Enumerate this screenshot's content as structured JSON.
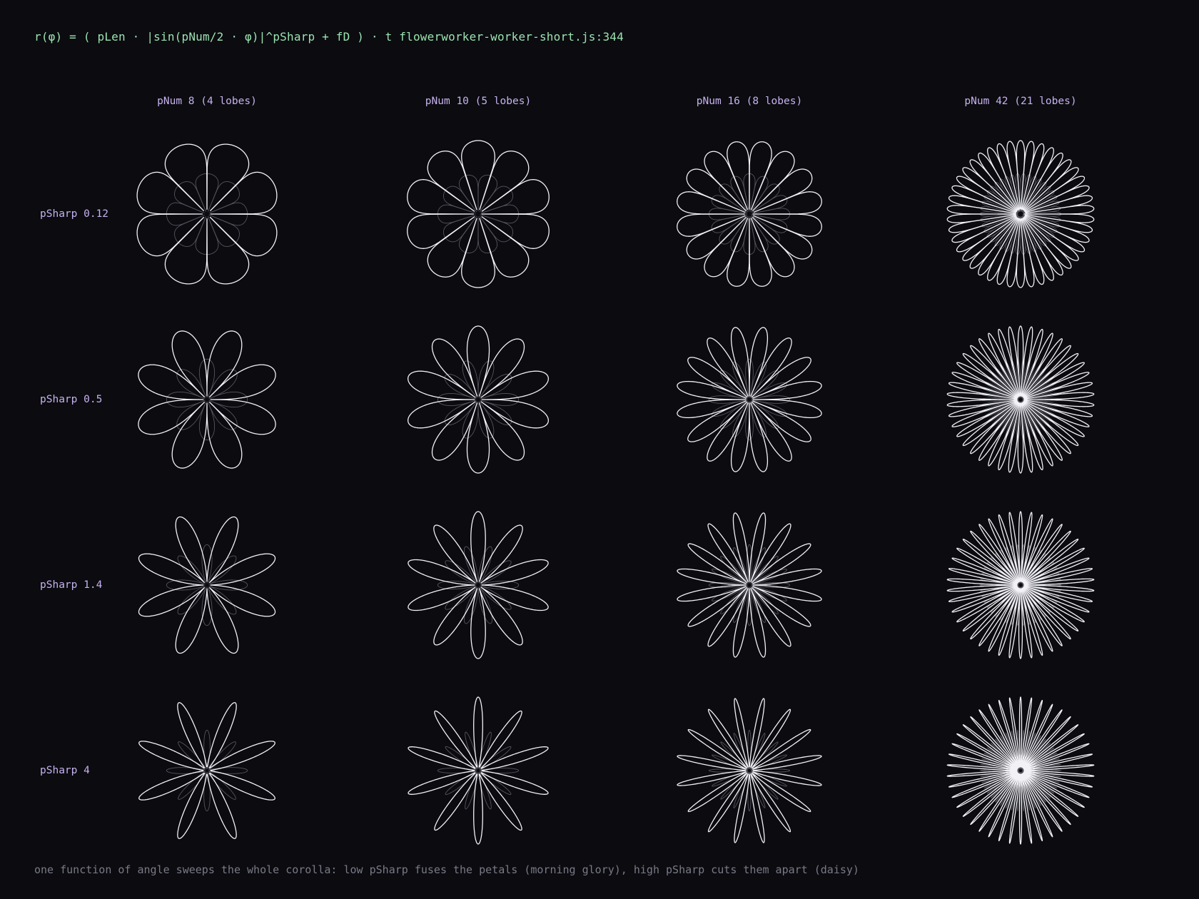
{
  "formula": "r(φ) = ( pLen · |sin(pNum/2 · φ)|^pSharp + fD ) · t flowerworker-worker-short.js:344",
  "columns": [
    {
      "label": "pNum 8 (4 lobes)",
      "pNum": 8
    },
    {
      "label": "pNum 10 (5 lobes)",
      "pNum": 10
    },
    {
      "label": "pNum 16 (8 lobes)",
      "pNum": 16
    },
    {
      "label": "pNum 42 (21 lobes)",
      "pNum": 42
    }
  ],
  "rows": [
    {
      "label": "pSharp 0.12",
      "pSharp": 0.12
    },
    {
      "label": "pSharp 0.5",
      "pSharp": 0.5
    },
    {
      "label": "pSharp 1.4",
      "pSharp": 1.4
    },
    {
      "label": "pSharp 4",
      "pSharp": 4
    }
  ],
  "caption": "one function of angle sweeps the whole corolla: low pSharp fuses the petals (morning glory), high pSharp cuts them apart (daisy)",
  "colors": {
    "background": "#0b0b10",
    "formula": "#9be3b0",
    "labels": "#c6b2ee",
    "caption": "#7a7a88",
    "petal_stroke": "#f2f2f6",
    "inner_stroke": "#55555f"
  }
}
